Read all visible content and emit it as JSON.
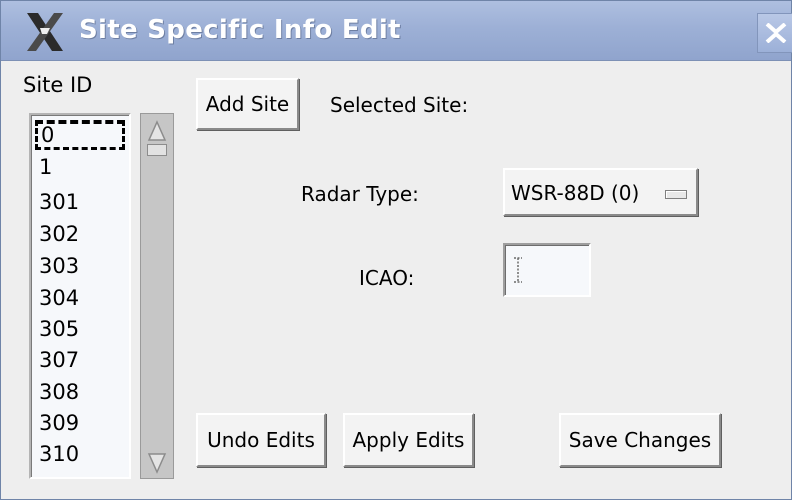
{
  "window": {
    "title": "Site Specific Info Edit",
    "icon": "x-window-icon",
    "close_icon": "close-icon"
  },
  "site_list": {
    "label": "Site ID",
    "items": [
      "0",
      "1",
      "301",
      "302",
      "303",
      "304",
      "305",
      "307",
      "308",
      "309",
      "310"
    ],
    "selected": "0"
  },
  "buttons": {
    "add_site": "Add Site",
    "undo_edits": "Undo Edits",
    "apply_edits": "Apply Edits",
    "save_changes": "Save Changes"
  },
  "selected_site": {
    "label": "Selected Site:",
    "value": ""
  },
  "radar_type": {
    "label": "Radar Type:",
    "value": "WSR-88D (0)"
  },
  "icao": {
    "label": "ICAO:",
    "value": ""
  },
  "colors": {
    "titlebar": "#9db0d6",
    "background": "#eeeeee",
    "list_background": "#f6f8fb"
  }
}
